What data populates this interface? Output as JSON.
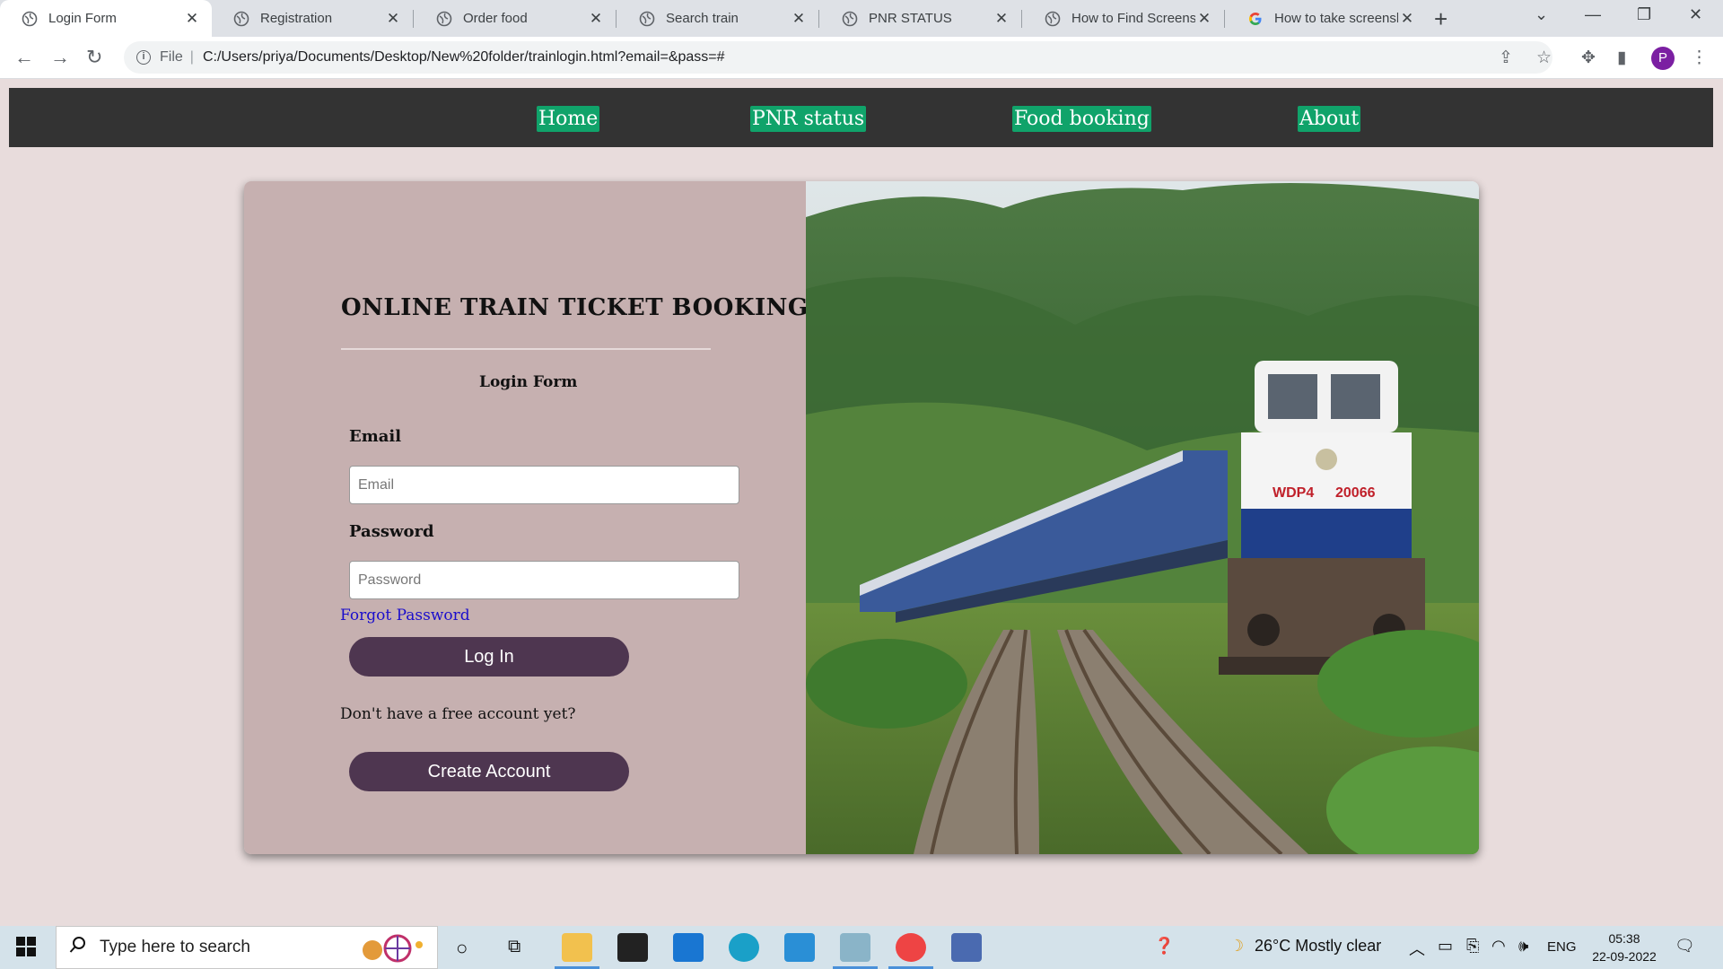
{
  "browser": {
    "tabs": [
      {
        "title": "Login Form",
        "active": true
      },
      {
        "title": "Registration",
        "active": false
      },
      {
        "title": "Order food",
        "active": false
      },
      {
        "title": "Search train",
        "active": false
      },
      {
        "title": "PNR STATUS",
        "active": false
      },
      {
        "title": "How to Find Screensh",
        "active": false
      },
      {
        "title": "How to take screensh",
        "active": false
      }
    ],
    "address": {
      "scheme_label": "File",
      "url": "C:/Users/priya/Documents/Desktop/New%20folder/trainlogin.html?email=&pass=#"
    },
    "profile_initial": "P"
  },
  "nav": {
    "links": [
      {
        "label": "Home"
      },
      {
        "label": "PNR status"
      },
      {
        "label": "Food booking"
      },
      {
        "label": "About"
      }
    ],
    "accent": "#10a36a",
    "background": "#333333"
  },
  "login": {
    "headline": "ONLINE TRAIN TICKET BOOKING",
    "subtitle": "Login Form",
    "email_label": "Email",
    "email_placeholder": "Email",
    "email_value": "",
    "password_label": "Password",
    "password_placeholder": "Password",
    "password_value": "",
    "forgot_link": "Forgot Password",
    "login_button": "Log In",
    "no_account_text": "Don't have a free account yet?",
    "create_button": "Create Account",
    "button_color": "#4e3650",
    "panel_color": "#c6b0b0"
  },
  "taskbar": {
    "search_placeholder": "Type here to search",
    "weather": "26°C  Mostly clear",
    "language": "ENG",
    "time": "05:38",
    "date": "22-09-2022"
  }
}
